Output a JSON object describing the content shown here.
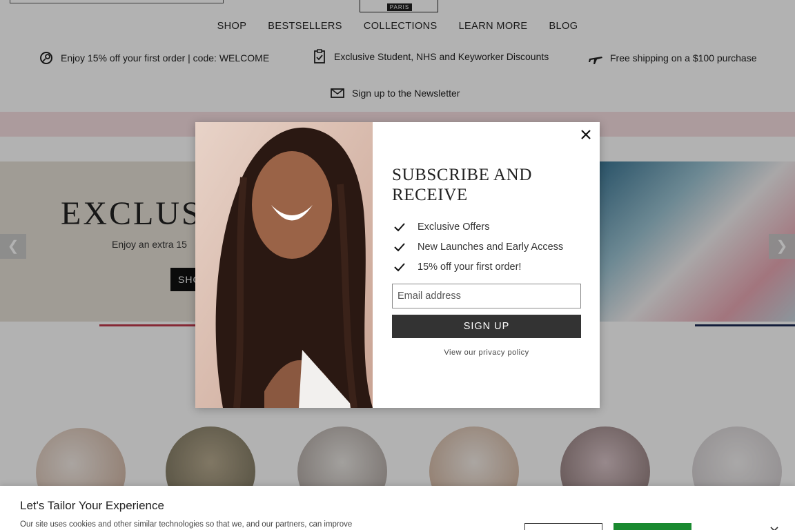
{
  "header": {
    "logo_sub": "PARIS",
    "nav": [
      "SHOP",
      "BESTSELLERS",
      "COLLECTIONS",
      "LEARN MORE",
      "BLOG"
    ]
  },
  "perks": {
    "discount": "Enjoy 15% off your first order | code: WELCOME",
    "student": "Exclusive Student, NHS and Keyworker Discounts",
    "shipping": "Free shipping on a $100 purchase",
    "newsletter": "Sign up to the Newsletter"
  },
  "hero": {
    "title": "EXCLUSI",
    "subtitle": "Enjoy an extra 15",
    "button": "SHO",
    "prev": "❮",
    "next": "❯"
  },
  "modal": {
    "title": "SUBSCRIBE AND RECEIVE",
    "benefits": [
      "Exclusive Offers",
      "New Launches and Early Access",
      "15% off your first order!"
    ],
    "email_placeholder": "Email address",
    "signup_label": "SIGN UP",
    "privacy_link": "View our privacy policy"
  },
  "cookie": {
    "title": "Let's Tailor Your Experience",
    "text": "Our site uses cookies and other similar technologies so that we, and our partners, can improve"
  },
  "colors": {
    "promo_strip": "#f6dfe1",
    "signup_button": "#333333",
    "cookie_accept": "#1a8a30",
    "progress_active": "#c03a4c",
    "progress_end": "#1c2a55"
  }
}
